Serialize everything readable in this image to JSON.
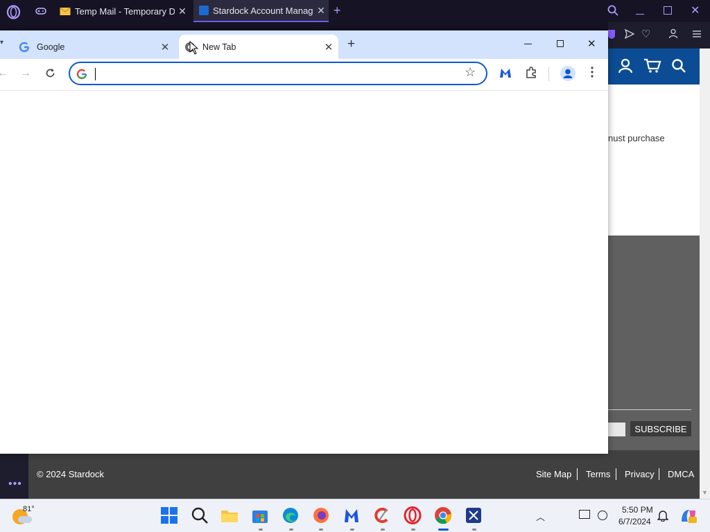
{
  "opera": {
    "tabs": [
      {
        "label": "Temp Mail - Temporary Dis"
      },
      {
        "label": "Stardock Account Manager"
      }
    ]
  },
  "stardock": {
    "partial_text": "nust purchase",
    "subscribe_label": "SUBSCRIBE",
    "copyright": "© 2024 Stardock",
    "footer_links": [
      "Site Map",
      "Terms",
      "Privacy",
      "DMCA"
    ]
  },
  "chrome": {
    "tabs": [
      {
        "label": "Google"
      },
      {
        "label": "New Tab"
      }
    ],
    "omnibox_value": ""
  },
  "taskbar": {
    "weather_temp": "81°",
    "time": "5:50 PM",
    "date": "6/7/2024"
  },
  "colors": {
    "opera_bg": "#161424",
    "stardock_blue": "#0c4c94",
    "chrome_accent": "#0b57d0",
    "chrome_tabstrip": "#d3e3fd"
  }
}
